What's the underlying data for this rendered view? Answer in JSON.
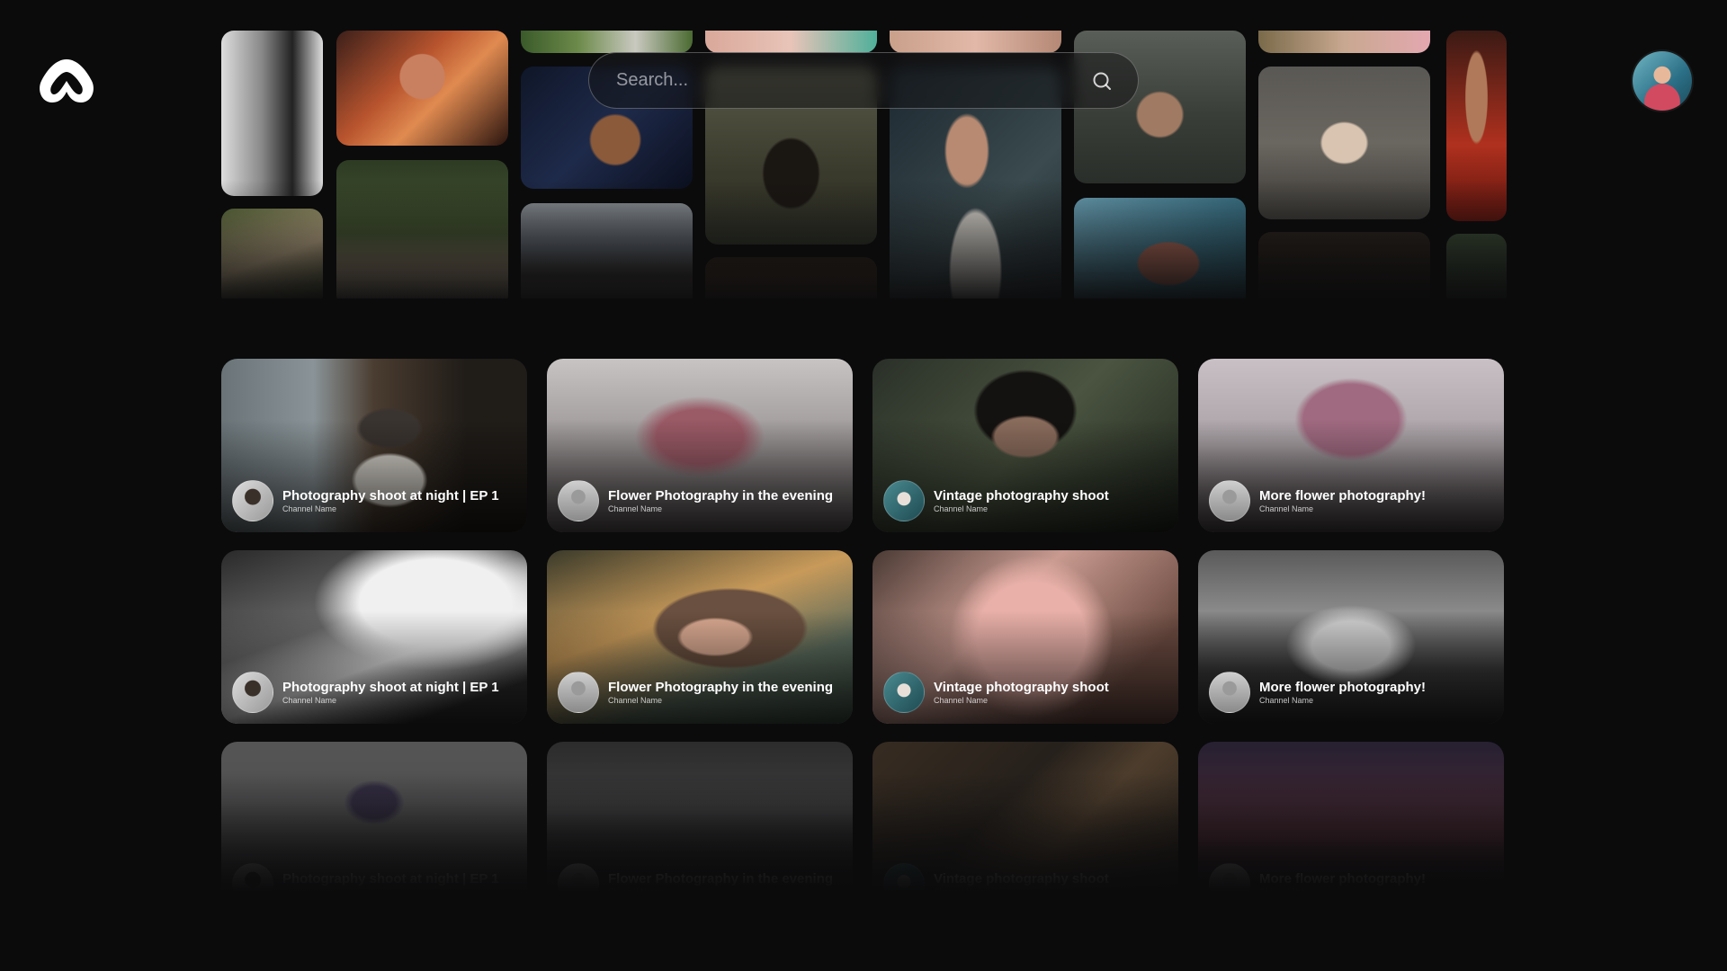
{
  "search": {
    "placeholder": "Search..."
  },
  "cards": [
    {
      "title": "Photography shoot at night | EP 1",
      "channel": "Channel Name"
    },
    {
      "title": "Flower Photography in the evening",
      "channel": "Channel Name"
    },
    {
      "title": "Vintage photography shoot",
      "channel": "Channel Name"
    },
    {
      "title": "More flower photography!",
      "channel": "Channel Name"
    },
    {
      "title": "Photography shoot at night | EP 1",
      "channel": "Channel Name"
    },
    {
      "title": "Flower Photography in the evening",
      "channel": "Channel Name"
    },
    {
      "title": "Vintage photography shoot",
      "channel": "Channel Name"
    },
    {
      "title": "More flower photography!",
      "channel": "Channel Name"
    },
    {
      "title": "Photography shoot at night | EP 1",
      "channel": "Channel Name"
    },
    {
      "title": "Flower Photography in the evening",
      "channel": "Channel Name"
    },
    {
      "title": "Vintage photography shoot",
      "channel": "Channel Name"
    },
    {
      "title": "More flower photography!",
      "channel": "Channel Name"
    }
  ],
  "colors": {
    "background": "#0b0b0c",
    "text": "#ffffff"
  },
  "icons": {
    "logo": "brand-logo-icon",
    "search": "search-icon",
    "profile": "user-avatar"
  }
}
